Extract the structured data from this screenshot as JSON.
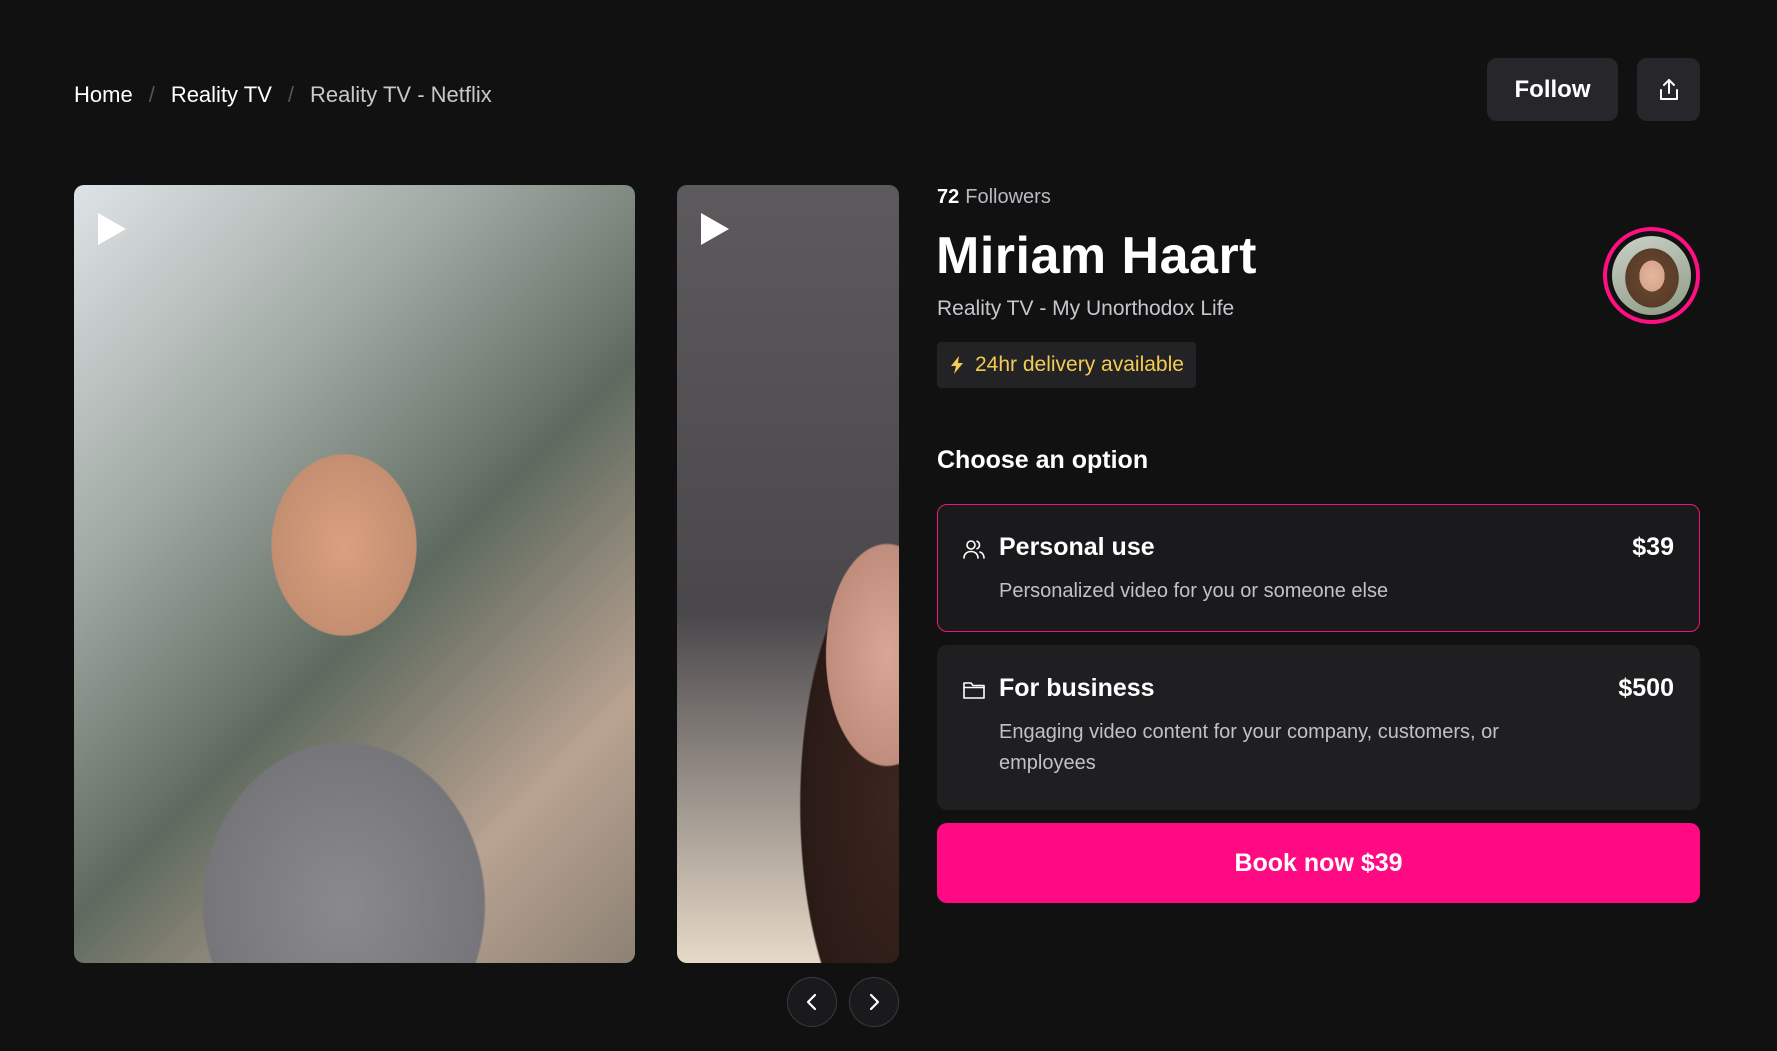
{
  "breadcrumb": {
    "items": [
      {
        "label": "Home"
      },
      {
        "label": "Reality TV"
      },
      {
        "label": "Reality TV - Netflix"
      }
    ],
    "separator": "/"
  },
  "header": {
    "follow_label": "Follow",
    "share_icon": "share-icon"
  },
  "videos": [
    {
      "icon": "play-icon"
    },
    {
      "icon": "play-icon"
    }
  ],
  "carousel": {
    "prev_icon": "chevron-left-icon",
    "next_icon": "chevron-right-icon"
  },
  "profile": {
    "followers_count": "72",
    "followers_label": "Followers",
    "name": "Miriam Haart",
    "category": "Reality TV - My Unorthodox Life",
    "delivery_badge": "24hr delivery available",
    "delivery_icon": "lightning-icon"
  },
  "options": {
    "title": "Choose an option",
    "items": [
      {
        "icon": "users-icon",
        "title": "Personal use",
        "price": "$39",
        "description": "Personalized video for you or someone else",
        "selected": true
      },
      {
        "icon": "folder-icon",
        "title": "For business",
        "price": "$500",
        "description": "Engaging video content for your company, customers, or employees",
        "selected": false
      }
    ]
  },
  "cta": {
    "book_label": "Book now $39"
  },
  "colors": {
    "background": "#111112",
    "accent": "#ff0a83",
    "badge_text": "#f5cc52",
    "card": "#1f1f22"
  }
}
